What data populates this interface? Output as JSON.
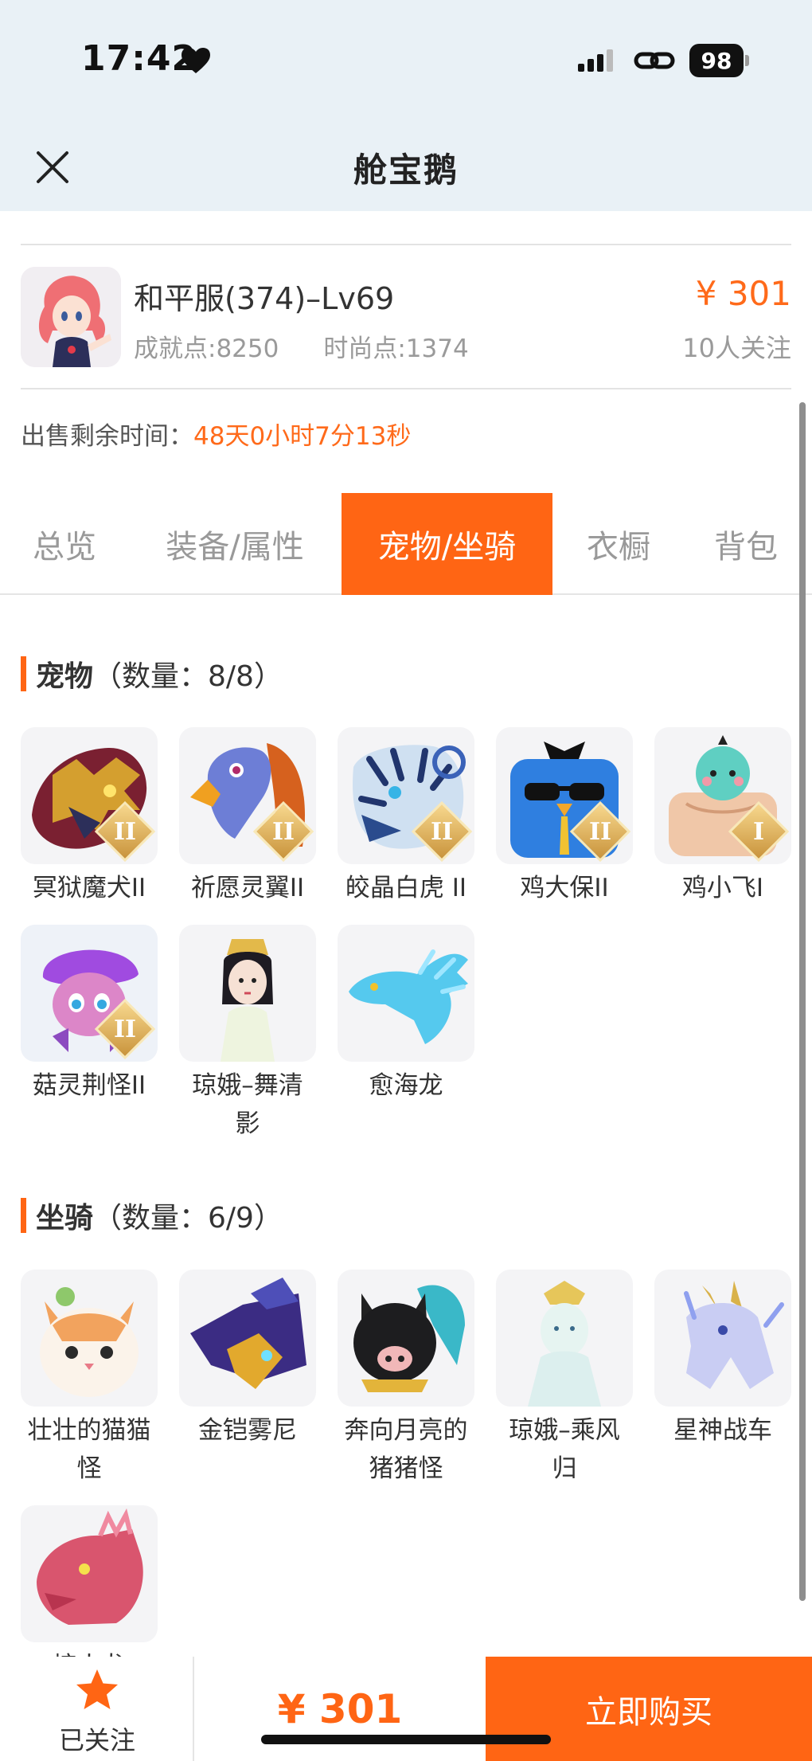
{
  "status_bar": {
    "time": "17:42",
    "battery": "98"
  },
  "nav": {
    "title": "舱宝鹅"
  },
  "listing": {
    "server_title": "和平服(374)–Lv69",
    "achievement": "成就点:8250",
    "fashion": "时尚点:1374",
    "price": "¥ 301",
    "followers": "10人关注",
    "sale_label": "出售剩余时间：",
    "sale_remaining": "48天0小时7分13秒"
  },
  "tabs": [
    {
      "label": "总览"
    },
    {
      "label": "装备/属性"
    },
    {
      "label": "宠物/坐骑"
    },
    {
      "label": "衣橱"
    },
    {
      "label": "背包"
    }
  ],
  "active_tab": "宠物/坐骑",
  "pets": {
    "title": "宠物",
    "count": "（数量：8/8）",
    "items": [
      {
        "name": "冥狱魔犬II",
        "rank": "II"
      },
      {
        "name": "祈愿灵翼II",
        "rank": "II"
      },
      {
        "name": "皎晶白虎 II",
        "rank": "II"
      },
      {
        "name": "鸡大保II",
        "rank": "II"
      },
      {
        "name": "鸡小飞I",
        "rank": "I"
      },
      {
        "name": "菇灵荆怪II",
        "rank": "II"
      },
      {
        "name": "琼娥–舞清影",
        "rank": ""
      },
      {
        "name": "愈海龙",
        "rank": ""
      }
    ]
  },
  "mounts": {
    "title": "坐骑",
    "count": "（数量：6/9）",
    "items": [
      {
        "name": "壮壮的猫猫怪"
      },
      {
        "name": "金铠雾尼"
      },
      {
        "name": "奔向月亮的猪猪怪"
      },
      {
        "name": "琼娥–乘风归"
      },
      {
        "name": "星神战车"
      },
      {
        "name": "熔火龙"
      }
    ]
  },
  "bottom": {
    "follow_label": "已关注",
    "price": "¥ 301",
    "buy_label": "立即购买"
  },
  "colors": {
    "accent": "#ff6514",
    "price": "#ff6a1a",
    "header_bg": "#e9f1f6",
    "muted_text": "#9a9a9a"
  }
}
